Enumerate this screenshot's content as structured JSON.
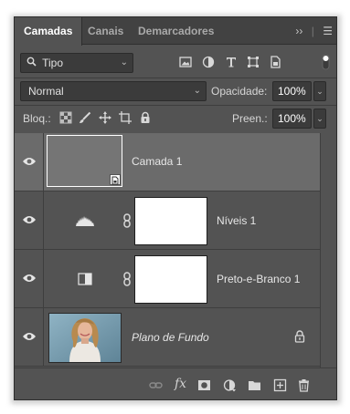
{
  "tabs": [
    {
      "label": "Camadas",
      "active": true
    },
    {
      "label": "Canais",
      "active": false
    },
    {
      "label": "Demarcadores",
      "active": false
    }
  ],
  "tab_icons": {
    "collapse": "››",
    "menu": "☰"
  },
  "filter": {
    "value": "Tipo",
    "icon": "search-icon"
  },
  "filter_icons": [
    "pixel-filter-icon",
    "adjustment-filter-icon",
    "type-filter-icon",
    "shape-filter-icon",
    "smart-object-filter-icon",
    "filter-toggle-icon"
  ],
  "blend": {
    "mode": "Normal",
    "opacity_label": "Opacidade:",
    "opacity_value": "100%"
  },
  "lock": {
    "label": "Bloq.:",
    "fill_label": "Preen.:",
    "fill_value": "100%"
  },
  "layers": [
    {
      "name": "Camada 1",
      "selected": true,
      "type": "pixel",
      "smart_object": true
    },
    {
      "name": "Níveis 1",
      "selected": false,
      "type": "adjustment",
      "adjustment_icon": "levels-histogram-icon"
    },
    {
      "name": "Preto-e-Branco 1",
      "selected": false,
      "type": "adjustment",
      "adjustment_icon": "black-white-icon"
    },
    {
      "name": "Plano de Fundo",
      "selected": false,
      "type": "background",
      "locked": true
    }
  ],
  "bottom_icons": [
    "link-layers-icon",
    "fx-icon",
    "add-mask-icon",
    "new-adjustment-icon",
    "new-group-icon",
    "new-layer-icon",
    "delete-icon"
  ],
  "bottom_fx_label": "fx",
  "colors": {
    "panel": "#535353",
    "selected_row": "#6b6b6b",
    "tabbar": "#424242",
    "field": "#3b3b3b"
  }
}
